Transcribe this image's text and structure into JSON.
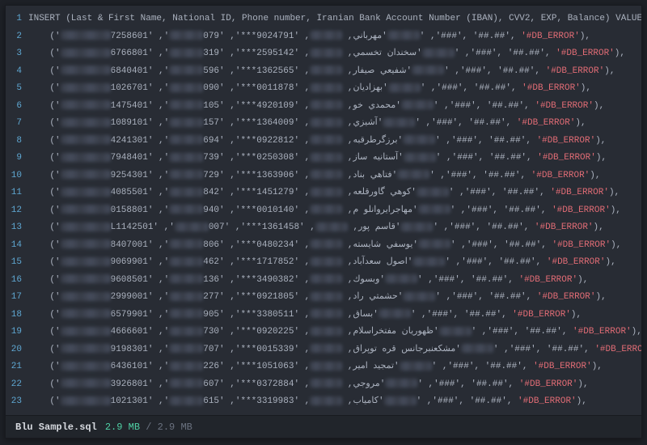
{
  "header_line": "INSERT  (Last & First Name, National ID, Phone number, Iranian Bank Account Number (IBAN), CVV2, EXP, Balance) VALUES",
  "common": {
    "cvv_mask": "'###'",
    "exp_mask": "'##.##'",
    "err": "'#DB_ERROR'",
    "row_close": "),",
    "row_open": "('"
  },
  "rows": [
    {
      "ln": 2,
      "id_suffix": "7258601'",
      "ph_suffix": "079'",
      "iban_suffix": "'***9024791'",
      "name": "مهرباني",
      "err_after_name": true
    },
    {
      "ln": 3,
      "id_suffix": "6766801'",
      "ph_suffix": "319'",
      "iban_suffix": "'***2595142'",
      "name": "سخندان تخسمي"
    },
    {
      "ln": 4,
      "id_suffix": "6840401'",
      "ph_suffix": "596'",
      "iban_suffix": "'***1362565'",
      "name": "شفيعي صيفار"
    },
    {
      "ln": 5,
      "id_suffix": "1026701'",
      "ph_suffix": "090'",
      "iban_suffix": "'***0011878'",
      "name": "بهزاديان"
    },
    {
      "ln": 6,
      "id_suffix": "1475401'",
      "ph_suffix": "105'",
      "iban_suffix": "'***4920109'",
      "name": "محمدي خو"
    },
    {
      "ln": 7,
      "id_suffix": "1089101'",
      "ph_suffix": "157'",
      "iban_suffix": "'***1364009'",
      "name": "آشيزي"
    },
    {
      "ln": 8,
      "id_suffix": "4241301'",
      "ph_suffix": "694'",
      "iban_suffix": "'***0922812'",
      "name": "برزگرطرقبه"
    },
    {
      "ln": 9,
      "id_suffix": "7948401'",
      "ph_suffix": "739'",
      "iban_suffix": "'***0250308'",
      "name": "آستانيه ساز"
    },
    {
      "ln": 10,
      "id_suffix": "9254301'",
      "ph_suffix": "729'",
      "iban_suffix": "'***1363906'",
      "name": "فتاهي بناد"
    },
    {
      "ln": 11,
      "id_suffix": "4085501'",
      "ph_suffix": "842'",
      "iban_suffix": "'***1451279'",
      "name": "كوهي گاورقلعه"
    },
    {
      "ln": 12,
      "id_suffix": "0158801'",
      "ph_suffix": "940'",
      "iban_suffix": "'***0010140'",
      "name": "مهاجرايروانلو م"
    },
    {
      "ln": 13,
      "id_suffix": "L1142501'",
      "ph_suffix": "007'",
      "iban_suffix": "'***1361458'",
      "name": "قاسم پور"
    },
    {
      "ln": 14,
      "id_suffix": "8407001'",
      "ph_suffix": "806'",
      "iban_suffix": "'***0480234'",
      "name": "يوسفي شايسته"
    },
    {
      "ln": 15,
      "id_suffix": "9069901'",
      "ph_suffix": "462'",
      "iban_suffix": "'***1717852'",
      "name": "اصول سعدآباد"
    },
    {
      "ln": 16,
      "id_suffix": "9608501'",
      "ph_suffix": "136'",
      "iban_suffix": "'***3490382'",
      "name": "وبسوك"
    },
    {
      "ln": 17,
      "id_suffix": "2999001'",
      "ph_suffix": "277'",
      "iban_suffix": "'***0921805'",
      "name": "حشمتي راد"
    },
    {
      "ln": 18,
      "id_suffix": "6579901'",
      "ph_suffix": "905'",
      "iban_suffix": "'***3380511'",
      "name": "بساق"
    },
    {
      "ln": 19,
      "id_suffix": "4666601'",
      "ph_suffix": "730'",
      "iban_suffix": "'***0920225'",
      "name": "ظهوريان مفتخراسلام"
    },
    {
      "ln": 20,
      "id_suffix": "9198301'",
      "ph_suffix": "707'",
      "iban_suffix": "'***0015339'",
      "name": "مشكعنبرجانس قره توپراق"
    },
    {
      "ln": 21,
      "id_suffix": "6436101'",
      "ph_suffix": "226'",
      "iban_suffix": "'***1051063'",
      "name": "تمجيد امير"
    },
    {
      "ln": 22,
      "id_suffix": "3926801'",
      "ph_suffix": "607'",
      "iban_suffix": "'***0372884'",
      "name": "مروجي"
    },
    {
      "ln": 23,
      "id_suffix": "1021301'",
      "ph_suffix": "615'",
      "iban_suffix": "'***3319983'",
      "name": "كامياب"
    }
  ],
  "status": {
    "filename": "Blu Sample.sql",
    "size_loaded": "2.9 MB",
    "size_sep": " / ",
    "size_total": "2.9 MB"
  }
}
